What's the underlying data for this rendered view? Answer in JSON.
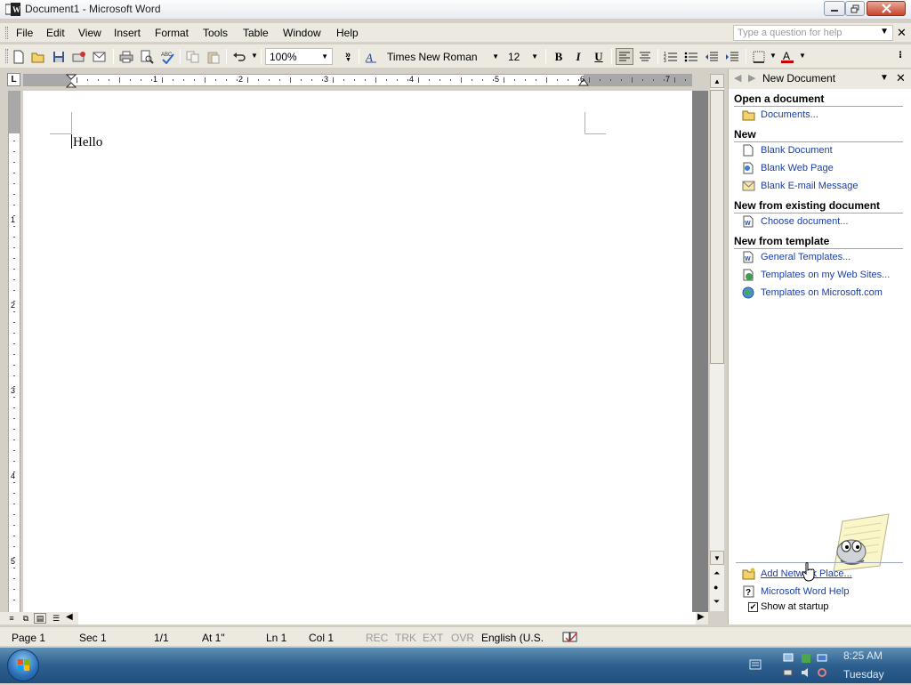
{
  "window": {
    "title": "Document1 - Microsoft Word"
  },
  "menubar": {
    "items": [
      "File",
      "Edit",
      "View",
      "Insert",
      "Format",
      "Tools",
      "Table",
      "Window",
      "Help"
    ],
    "help_placeholder": "Type a question for help"
  },
  "toolbar": {
    "zoom": "100%",
    "font": "Times New Roman",
    "size": "12",
    "bold": "B",
    "italic": "I",
    "underline": "U",
    "font_color_letter": "A",
    "font_color": "#cc0000"
  },
  "ruler": {
    "corner": "L",
    "h_numbers": [
      "1",
      "2",
      "3",
      "4",
      "5",
      "6",
      "7"
    ],
    "v_numbers": [
      "1",
      "2",
      "3",
      "4",
      "5"
    ]
  },
  "document": {
    "text": "Hello"
  },
  "taskpane": {
    "title": "New Document",
    "sections": {
      "open": "Open a document",
      "new": "New",
      "existing": "New from existing document",
      "template": "New from template"
    },
    "links": {
      "documents": "Documents...",
      "blank_document": "Blank Document",
      "blank_web_page": "Blank Web Page",
      "blank_email": "Blank E-mail Message",
      "choose_document": "Choose document...",
      "general_templates": "General Templates...",
      "templates_web_sites": "Templates on my Web Sites...",
      "templates_microsoft": "Templates on Microsoft.com",
      "add_network_place": "Add Network Place...",
      "word_help": "Microsoft Word Help"
    },
    "show_at_startup": "Show at startup",
    "show_at_startup_checked": true
  },
  "statusbar": {
    "page": "Page 1",
    "sec": "Sec 1",
    "pages": "1/1",
    "at": "At 1\"",
    "ln": "Ln 1",
    "col": "Col 1",
    "rec": "REC",
    "trk": "TRK",
    "ext": "EXT",
    "ovr": "OVR",
    "language": "English (U.S."
  },
  "taskbar": {
    "time": "8:25 AM",
    "day": "Tuesday"
  },
  "colors": {
    "link": "#1a3fa8",
    "taskbar": "#2d5f8f",
    "ruler_margin": "#a8a8a8"
  }
}
